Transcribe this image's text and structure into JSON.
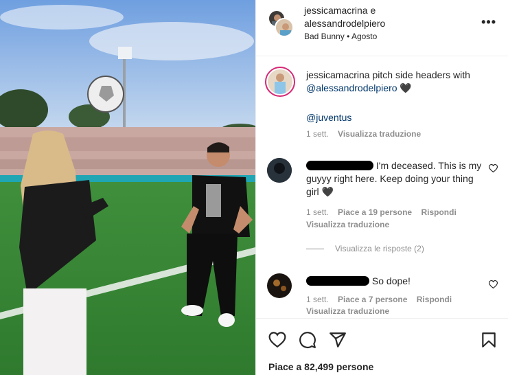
{
  "post": {
    "header": {
      "users_line1": "jessicamacrina e",
      "users_line2": "alessandrodelpiero",
      "music": "Bad Bunny",
      "separator": "•",
      "location": "Agosto",
      "more_icon": "more-horizontal-icon",
      "more_label": "•••"
    },
    "caption": {
      "username": "jessicamacrina",
      "text": "pitch side headers with",
      "mention": "@alessandrodelpiero",
      "emoji": "🖤",
      "hashtag_mention": "@juventus",
      "time": "1 sett.",
      "translate": "Visualizza traduzione"
    },
    "comments": [
      {
        "text": "I'm deceased. This is my guyyy right here. Keep doing your thing girl",
        "emoji": "🖤",
        "time": "1 sett.",
        "likes": "Piace a 19 persone",
        "reply": "Rispondi",
        "translate": "Visualizza traduzione"
      },
      {
        "text": "So dope!",
        "time": "1 sett.",
        "likes": "Piace a 7 persone",
        "reply": "Rispondi",
        "translate": "Visualizza traduzione"
      }
    ],
    "view_replies": "Visualizza le risposte (2)",
    "actions": [
      "heart-icon",
      "comment-icon",
      "share-icon",
      "bookmark-icon"
    ],
    "likes_count": "Piace a 82,499 persone"
  }
}
